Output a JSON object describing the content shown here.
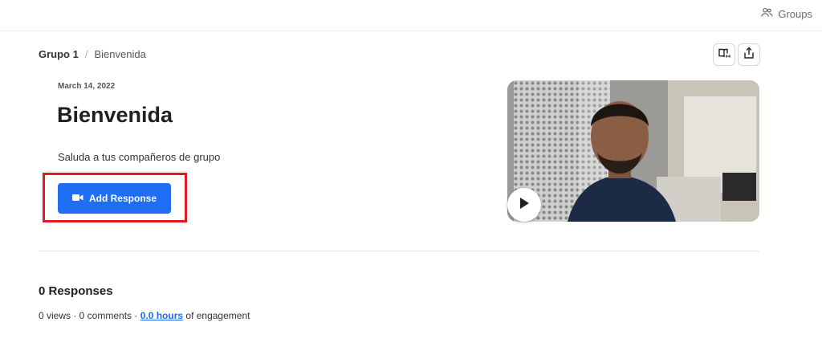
{
  "header": {
    "groups_label": "Groups"
  },
  "breadcrumb": {
    "group": "Grupo 1",
    "separator": "/",
    "page": "Bienvenida"
  },
  "topic": {
    "date": "March 14, 2022",
    "title": "Bienvenida",
    "description": "Saluda a tus compañeros de grupo"
  },
  "actions": {
    "add_response_label": "Add Response"
  },
  "responses": {
    "title": "0 Responses",
    "stats_prefix": "0 views · 0 comments · ",
    "hours_link": "0.0 hours",
    "stats_suffix": " of engagement"
  },
  "colors": {
    "accent": "#1f6ef5",
    "highlight": "#e01b24"
  },
  "icons": {
    "groups": "groups-icon",
    "immersive_reader": "immersive-reader-icon",
    "share": "share-icon",
    "camera": "video-camera-icon",
    "play": "play-icon"
  }
}
